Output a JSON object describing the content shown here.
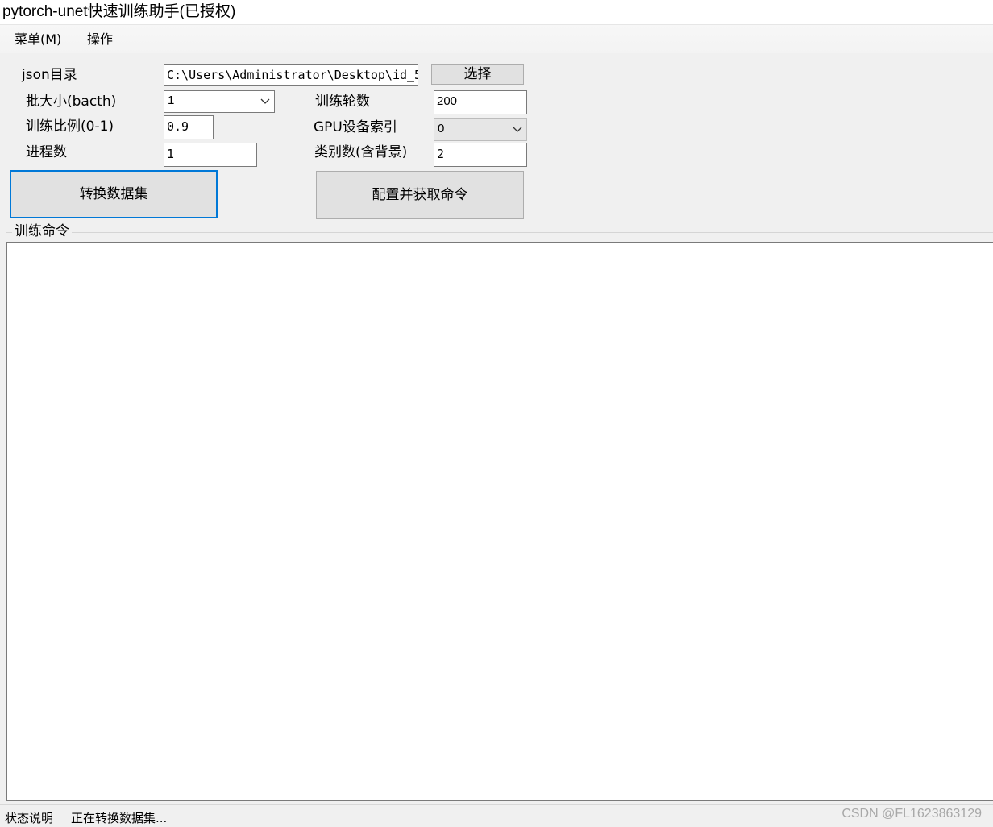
{
  "window": {
    "title": "pytorch-unet快速训练助手(已授权)"
  },
  "menubar": {
    "menu_label": "菜单(M)",
    "operate_label": "操作"
  },
  "form": {
    "json_dir_label": "json目录",
    "json_dir_value": "C:\\Users\\Administrator\\Desktop\\id_5",
    "choose_button": "选择",
    "batch_label": "批大小(bacth)",
    "batch_value": "1",
    "epochs_label": "训练轮数",
    "epochs_value": "200",
    "train_ratio_label": "训练比例(0-1)",
    "train_ratio_value": "0.9",
    "gpu_label": "GPU设备索引",
    "gpu_value": "0",
    "workers_label": "进程数",
    "workers_value": "1",
    "classes_label": "类别数(含背景)",
    "classes_value": "2",
    "convert_button": "转换数据集",
    "config_button": "配置并获取命令"
  },
  "command_group": {
    "label": "训练命令",
    "value": ""
  },
  "statusbar": {
    "label": "状态说明",
    "message": "正在转换数据集...",
    "watermark": "CSDN @FL1623863129"
  },
  "colors": {
    "window_bg": "#f0f0f0",
    "focus_border": "#0078d7",
    "button_bg": "#e1e1e1"
  }
}
